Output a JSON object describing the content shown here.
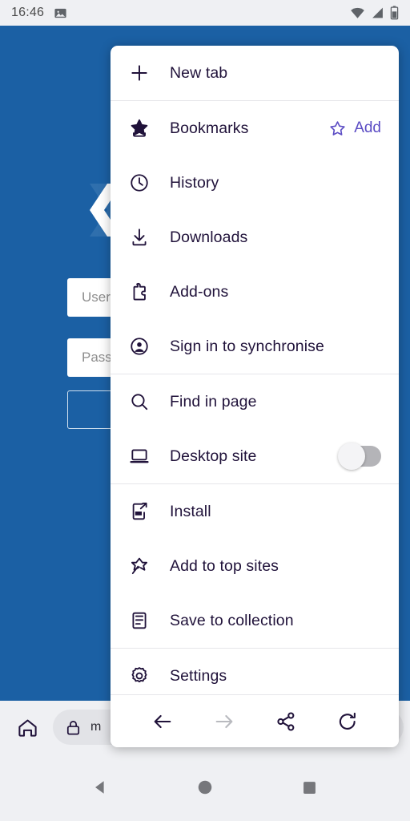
{
  "statusbar": {
    "time": "16:46",
    "icons": [
      "image-icon",
      "wifi-icon",
      "cell-signal-icon",
      "battery-icon"
    ]
  },
  "page": {
    "logo_alt": "site-logo",
    "username_placeholder": "Username",
    "password_placeholder": "Password",
    "login_button": "",
    "background_color": "#1b60a4"
  },
  "browser_bar": {
    "home_icon": "home-icon",
    "lock_icon": "lock-icon",
    "url_text": "m"
  },
  "menu": {
    "accent_color": "#5b4cc4",
    "ink_color": "#20123a",
    "items": [
      {
        "icon": "plus-icon",
        "label": "New tab"
      },
      {
        "icon": "bookmark-star-icon",
        "label": "Bookmarks",
        "action_icon": "star-outline-icon",
        "action_label": "Add"
      },
      {
        "icon": "clock-icon",
        "label": "History"
      },
      {
        "icon": "download-icon",
        "label": "Downloads"
      },
      {
        "icon": "puzzle-icon",
        "label": "Add-ons"
      },
      {
        "icon": "account-circle-icon",
        "label": "Sign in to synchronise"
      },
      {
        "icon": "search-icon",
        "label": "Find in page"
      },
      {
        "icon": "laptop-icon",
        "label": "Desktop site",
        "toggle": "off"
      },
      {
        "icon": "install-phone-icon",
        "label": "Install"
      },
      {
        "icon": "pin-star-icon",
        "label": "Add to top sites"
      },
      {
        "icon": "collection-icon",
        "label": "Save to collection"
      },
      {
        "icon": "gear-icon",
        "label": "Settings"
      }
    ],
    "toolbar": [
      {
        "icon": "back-arrow-icon",
        "state": "enabled"
      },
      {
        "icon": "forward-arrow-icon",
        "state": "disabled"
      },
      {
        "icon": "share-icon",
        "state": "enabled"
      },
      {
        "icon": "reload-icon",
        "state": "enabled"
      }
    ]
  },
  "android_nav": {
    "back": "triangle-back-icon",
    "home": "circle-home-icon",
    "recents": "square-recents-icon"
  }
}
